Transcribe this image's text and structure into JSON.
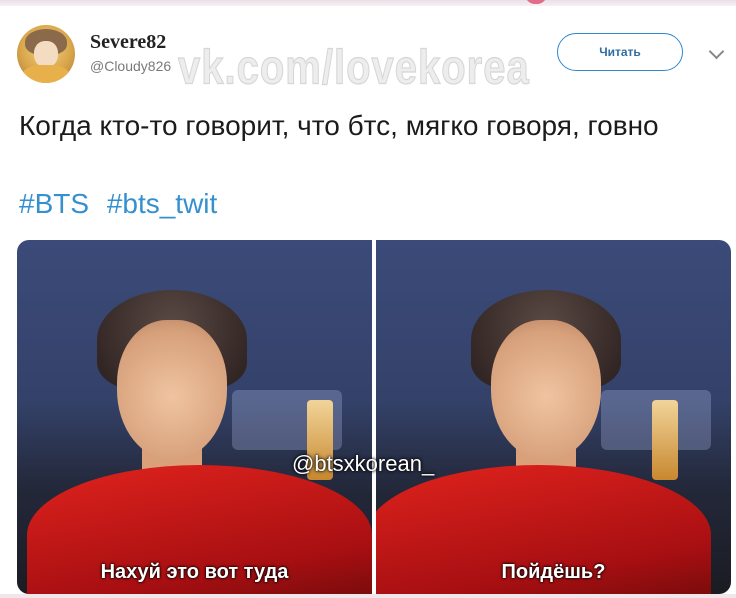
{
  "tweet": {
    "username": "Severe82",
    "handle": "@Cloudy826",
    "read_button": "Читать",
    "text": "Когда кто-то говорит, что бтс, мягко говоря, говно",
    "hashtags": [
      "#BTS",
      "#bts_twit"
    ]
  },
  "watermark": "vk.com/lovekorea",
  "images": {
    "left_caption": "Нахуй это вот туда",
    "right_caption": "Пойдёшь?",
    "credit": "@btsxkorean_"
  },
  "colors": {
    "hashtag": "#3690cf",
    "button_border": "#2f88d0",
    "shirt": "#d11a17"
  }
}
